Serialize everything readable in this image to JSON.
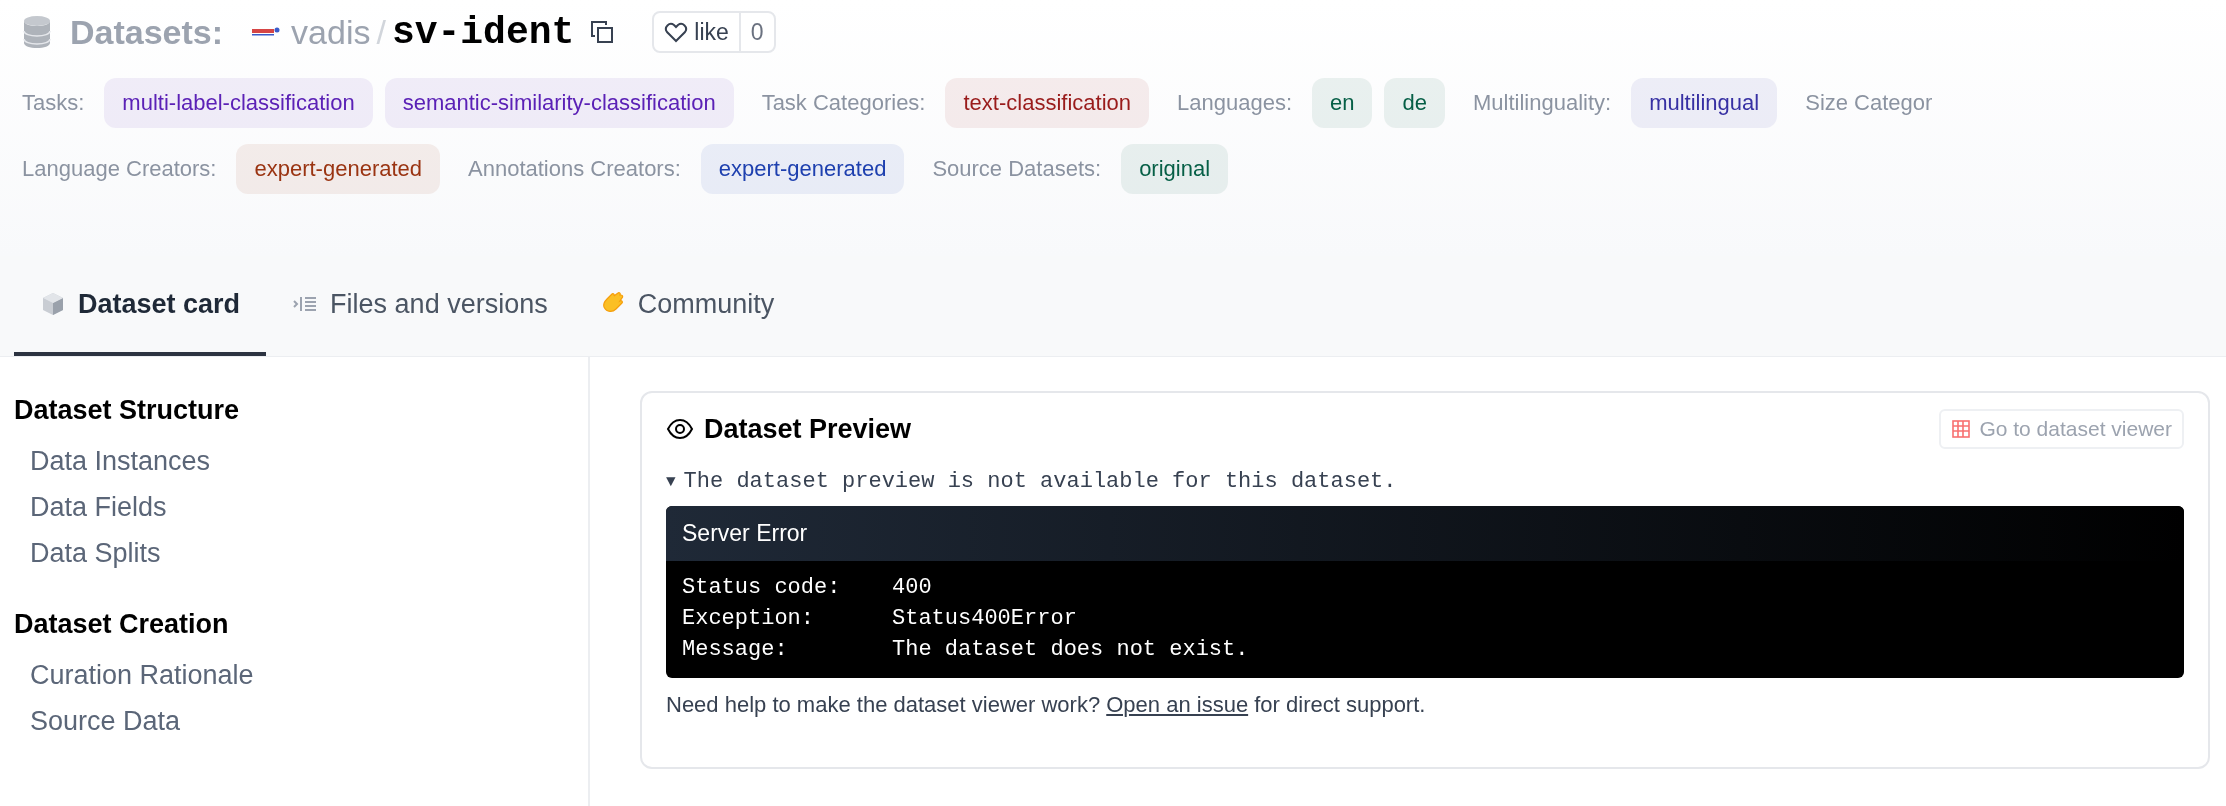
{
  "header": {
    "section": "Datasets:",
    "owner": "vadis",
    "separator": "/",
    "name": "sv-ident",
    "like_label": "like",
    "like_count": "0"
  },
  "tag_rows": [
    {
      "groups": [
        {
          "label": "Tasks:",
          "color": "#5b21b6",
          "tags": [
            "multi-label-classification",
            "semantic-similarity-classification"
          ]
        },
        {
          "label": "Task Categories:",
          "color": "#991b1b",
          "tags": [
            "text-classification"
          ]
        },
        {
          "label": "Languages:",
          "color": "#065f46",
          "tags": [
            "en",
            "de"
          ]
        },
        {
          "label": "Multilinguality:",
          "color": "#3730a3",
          "tags": [
            "multilingual"
          ]
        },
        {
          "label": "Size Categor"
        }
      ]
    },
    {
      "groups": [
        {
          "label": "Language Creators:",
          "color": "#9a3412",
          "tags": [
            "expert-generated"
          ]
        },
        {
          "label": "Annotations Creators:",
          "color": "#1e40af",
          "tags": [
            "expert-generated"
          ]
        },
        {
          "label": "Source Datasets:",
          "color": "#065f46",
          "tags": [
            "original"
          ]
        }
      ]
    }
  ],
  "tabs": [
    {
      "label": "Dataset card",
      "selected": true,
      "kind": "cube"
    },
    {
      "label": "Files and versions",
      "selected": false,
      "kind": "files"
    },
    {
      "label": "Community",
      "selected": false,
      "kind": "hand"
    }
  ],
  "sidebar": [
    {
      "heading": "Dataset Structure",
      "items": [
        "Data Instances",
        "Data Fields",
        "Data Splits"
      ]
    },
    {
      "heading": "Dataset Creation",
      "items": [
        "Curation Rationale",
        "Source Data"
      ]
    }
  ],
  "preview": {
    "title": "Dataset Preview",
    "viewer_button": "Go to dataset viewer",
    "summary_marker": "▼",
    "summary": "The dataset preview is not available for this dataset.",
    "error": {
      "title": "Server Error",
      "rows": [
        {
          "label": "Status code:",
          "value": "400"
        },
        {
          "label": "Exception:",
          "value": "Status400Error"
        },
        {
          "label": "Message:",
          "value": "The dataset does not exist."
        }
      ]
    },
    "help": {
      "before": "Need help to make the dataset viewer work? ",
      "link": "Open an issue",
      "after": " for direct support."
    }
  }
}
